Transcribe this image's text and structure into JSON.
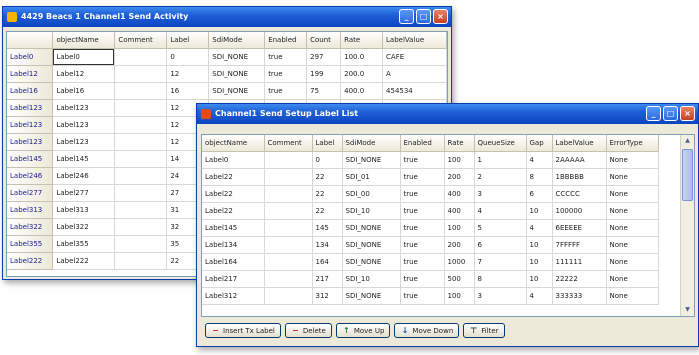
{
  "back_window": {
    "title": "4429 Beacs 1 Channel1 Send Activity",
    "columns": [
      "",
      "objectName",
      "Comment",
      "Label",
      "SdiMode",
      "Enabled",
      "Count",
      "Rate",
      "LabelValue"
    ],
    "rows": [
      [
        "Label0",
        "Label0",
        "",
        "0",
        "SDI_NONE",
        "true",
        "297",
        "100.0",
        "CAFE"
      ],
      [
        "Label12",
        "Label12",
        "",
        "12",
        "SDI_NONE",
        "true",
        "199",
        "200.0",
        "A"
      ],
      [
        "Label16",
        "Label16",
        "",
        "16",
        "SDI_NONE",
        "true",
        "75",
        "400.0",
        "454534"
      ],
      [
        "Label123",
        "Label123",
        "",
        "12",
        "",
        "",
        "",
        "",
        ""
      ],
      [
        "Label123",
        "Label123",
        "",
        "12",
        "",
        "",
        "",
        "",
        ""
      ],
      [
        "Label123",
        "Label123",
        "",
        "12",
        "",
        "",
        "",
        "",
        ""
      ],
      [
        "Label145",
        "Label145",
        "",
        "14",
        "",
        "",
        "",
        "",
        ""
      ],
      [
        "Label246",
        "Label246",
        "",
        "24",
        "",
        "",
        "",
        "",
        ""
      ],
      [
        "Label277",
        "Label277",
        "",
        "27",
        "",
        "",
        "",
        "",
        ""
      ],
      [
        "Label313",
        "Label313",
        "",
        "31",
        "",
        "",
        "",
        "",
        ""
      ],
      [
        "Label322",
        "Label322",
        "",
        "32",
        "",
        "",
        "",
        "",
        ""
      ],
      [
        "Label355",
        "Label355",
        "",
        "35",
        "",
        "",
        "",
        "",
        ""
      ],
      [
        "Label222",
        "Label222",
        "",
        "22",
        "",
        "",
        "",
        "",
        ""
      ]
    ]
  },
  "front_window": {
    "title": "Channel1 Send Setup Label List",
    "columns": [
      "objectName",
      "Comment",
      "Label",
      "SdiMode",
      "Enabled",
      "Rate",
      "QueueSize",
      "Gap",
      "LabelValue",
      "ErrorType"
    ],
    "rows": [
      [
        "Label0",
        "",
        "0",
        "SDI_NONE",
        "true",
        "100",
        "1",
        "4",
        "2AAAAA",
        "None"
      ],
      [
        "Label22",
        "",
        "22",
        "SDI_01",
        "true",
        "200",
        "2",
        "8",
        "1BBBBB",
        "None"
      ],
      [
        "Label22",
        "",
        "22",
        "SDI_00",
        "true",
        "400",
        "3",
        "6",
        "CCCCC",
        "None"
      ],
      [
        "Label22",
        "",
        "22",
        "SDI_10",
        "true",
        "400",
        "4",
        "10",
        "100000",
        "None"
      ],
      [
        "Label145",
        "",
        "145",
        "SDI_NONE",
        "true",
        "100",
        "5",
        "4",
        "6EEEEE",
        "None"
      ],
      [
        "Label134",
        "",
        "134",
        "SDI_NONE",
        "true",
        "200",
        "6",
        "10",
        "7FFFFF",
        "None"
      ],
      [
        "Label164",
        "",
        "164",
        "SDI_NONE",
        "true",
        "1000",
        "7",
        "10",
        "111111",
        "None"
      ],
      [
        "Label217",
        "",
        "217",
        "SDI_10",
        "true",
        "500",
        "8",
        "10",
        "22222",
        "None"
      ],
      [
        "Label312",
        "",
        "312",
        "SDI_NONE",
        "true",
        "100",
        "3",
        "4",
        "333333",
        "None"
      ]
    ],
    "buttons": [
      {
        "label": "Insert Tx Label",
        "icon": "minus-icon"
      },
      {
        "label": "Delete",
        "icon": "minus-icon"
      },
      {
        "label": "Move Up",
        "icon": "arrow-up-icon"
      },
      {
        "label": "Move Down",
        "icon": "arrow-down-icon"
      },
      {
        "label": "Filter",
        "icon": "filter-icon"
      }
    ]
  }
}
